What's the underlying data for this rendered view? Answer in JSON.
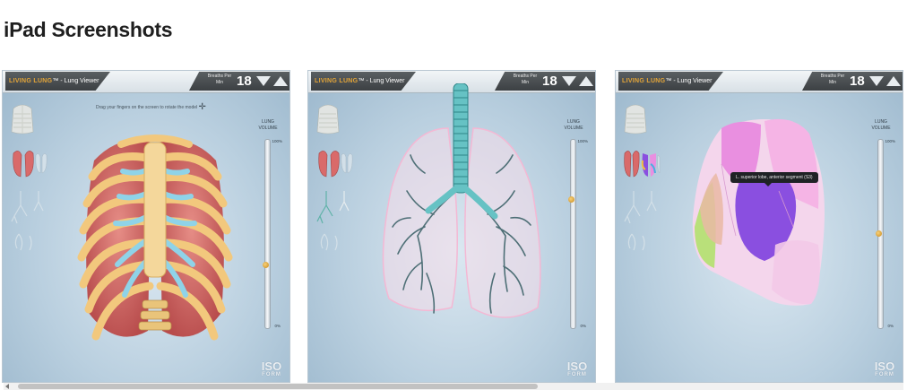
{
  "section": {
    "title": "iPad Screenshots"
  },
  "screenshots": [
    {
      "brand_name": "LIVING LUNG",
      "brand_suffix": "™ - Lung Viewer",
      "breaths_label": "Breaths Per Min",
      "breaths_value": "18",
      "hint": "Drag your fingers on the screen to rotate the model",
      "volume_label": "LUNG VOLUME",
      "volume_max": "100%",
      "volume_min": "0%",
      "volume_level": 0.33,
      "logo": "ISO",
      "logo_sub": "FORM"
    },
    {
      "brand_name": "LIVING LUNG",
      "brand_suffix": "™ - Lung Viewer",
      "breaths_label": "Breaths Per Min",
      "breaths_value": "18",
      "volume_label": "LUNG VOLUME",
      "volume_max": "100%",
      "volume_min": "0%",
      "volume_level": 0.68,
      "logo": "ISO",
      "logo_sub": "FORM"
    },
    {
      "brand_name": "LIVING LUNG",
      "brand_suffix": "™ - Lung Viewer",
      "breaths_label": "Breaths Per Min",
      "breaths_value": "18",
      "tooltip": "L. superior lobe, anterior segment (S3)",
      "volume_label": "LUNG VOLUME",
      "volume_max": "100%",
      "volume_min": "0%",
      "volume_level": 0.5,
      "logo": "ISO",
      "logo_sub": "FORM"
    }
  ],
  "colors": {
    "brand_orange": "#e3a437",
    "toolbar_dark": "#3c4043",
    "bone": "#f0c877",
    "cartilage": "#8fd3e8",
    "lung_tissue": "#d77777",
    "airway_teal": "#4aa3a6",
    "segment_purple": "#8a4fe0",
    "segment_pink": "#e98fe0"
  },
  "icons": {
    "ribcage": "ribcage-icon",
    "lungs": "lungs-icon",
    "airways": "airways-icon",
    "decrease": "triangle-down-icon",
    "increase": "triangle-up-icon"
  }
}
